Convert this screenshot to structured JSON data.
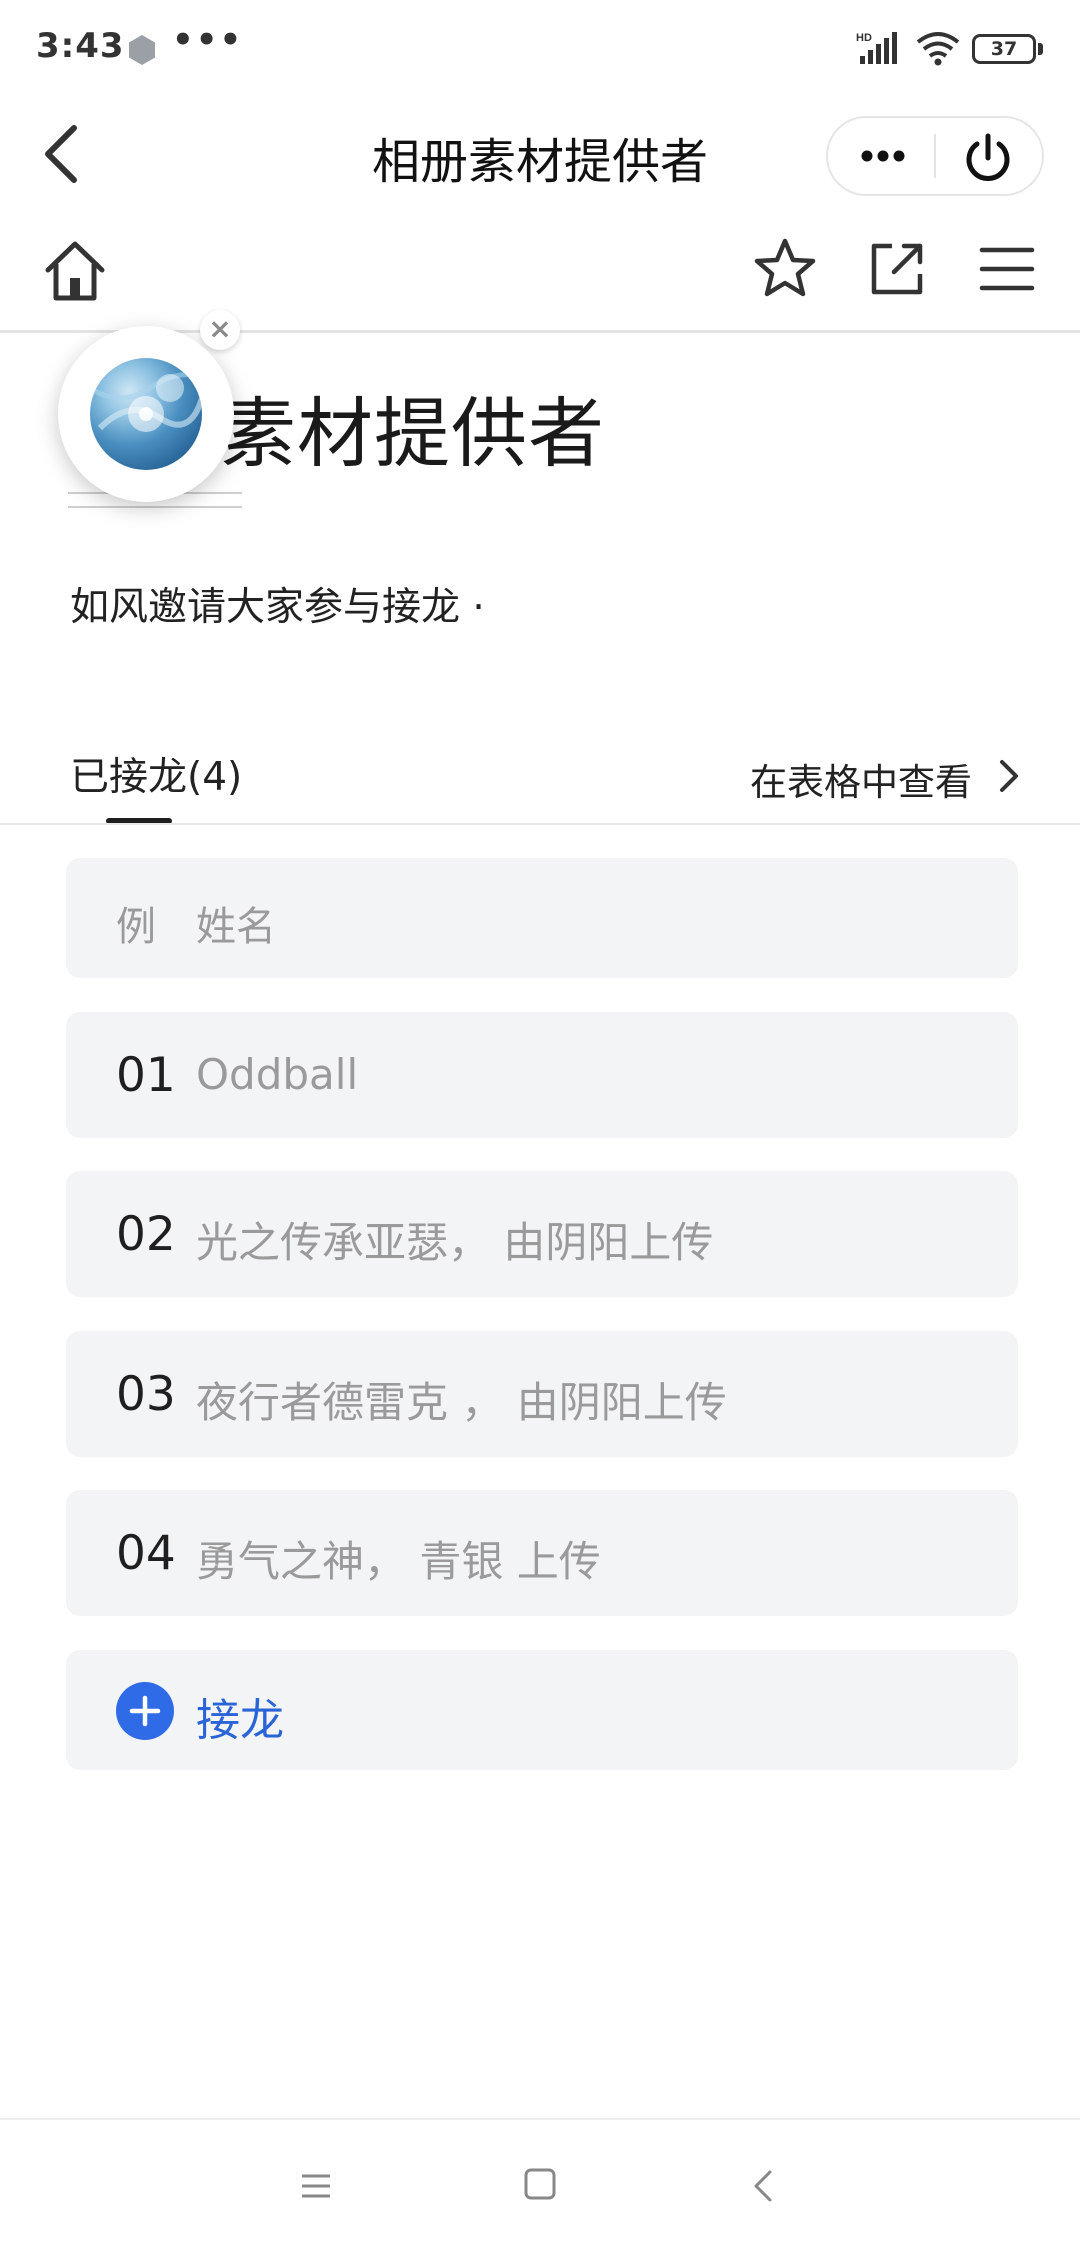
{
  "status_bar": {
    "time": "3:43",
    "dots": "•••",
    "battery": "37"
  },
  "nav": {
    "title": "相册素材提供者",
    "capsule_more_icon": "more-dots-icon",
    "capsule_power_icon": "power-icon"
  },
  "toolbar": {
    "home_icon": "home-icon",
    "star_icon": "star-icon",
    "share_icon": "share-icon",
    "menu_icon": "menu-icon"
  },
  "header": {
    "title": "素材提供者",
    "invite_text": "如风邀请大家参与接龙 ·"
  },
  "tabs": {
    "joined_label": "已接龙(4)",
    "view_in_table": "在表格中查看"
  },
  "list": {
    "example": {
      "num": "例",
      "text": "姓名"
    },
    "items": [
      {
        "num": "01",
        "text": "Oddball"
      },
      {
        "num": "02",
        "text": "光之传承亚瑟， 由阴阳上传"
      },
      {
        "num": "03",
        "text": "夜行者德雷克 ， 由阴阳上传"
      },
      {
        "num": "04",
        "text": "勇气之神， 青银 上传"
      }
    ],
    "add_label": "接龙"
  },
  "colors": {
    "accent": "#2f6be6",
    "row_bg": "#f3f4f6",
    "muted_text": "#9a9a9a"
  }
}
